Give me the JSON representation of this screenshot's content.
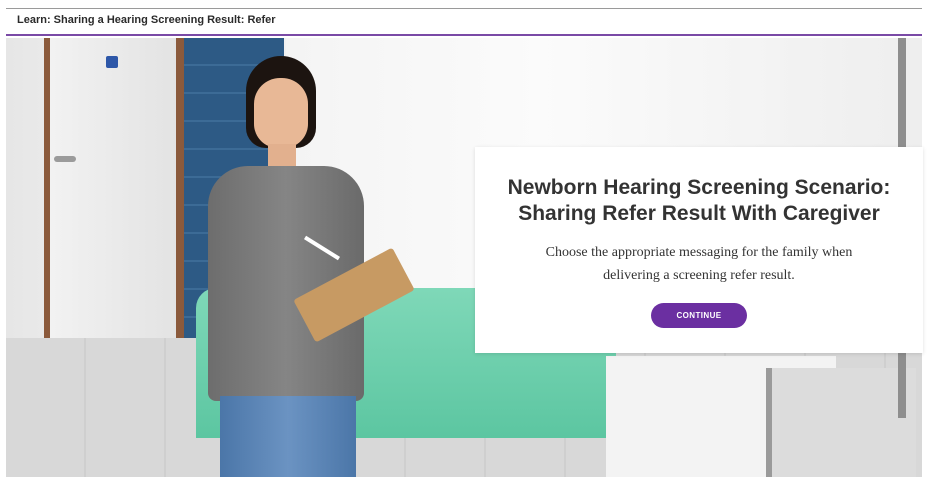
{
  "header": {
    "title": "Learn: Sharing a Hearing Screening Result: Refer"
  },
  "card": {
    "title_line1": "Newborn Hearing Screening Scenario:",
    "title_line2": "Sharing Refer Result With Caregiver",
    "text_line1": "Choose the appropriate messaging for the family when",
    "text_line2": "delivering a screening refer result.",
    "button_label": "CONTINUE"
  },
  "colors": {
    "accent": "#6b2fa1",
    "header_rule": "#7a4aa6"
  }
}
